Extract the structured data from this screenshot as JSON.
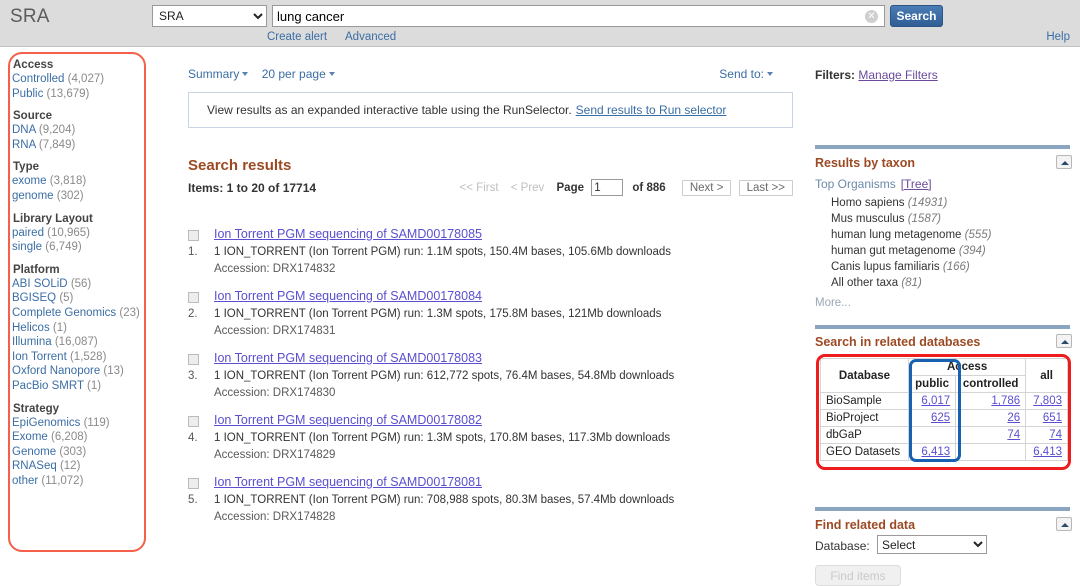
{
  "header": {
    "logo": "SRA",
    "db_selected": "SRA",
    "db_options": [
      "SRA"
    ],
    "search_value": "lung cancer ",
    "search_placeholder": "",
    "clear_icon": "clear-icon",
    "search_button": "Search",
    "create_alert": "Create alert",
    "advanced": "Advanced",
    "help": "Help"
  },
  "facets": [
    {
      "title": "Access",
      "items": [
        {
          "label": "Controlled",
          "count": "(4,027)"
        },
        {
          "label": "Public",
          "count": "(13,679)"
        }
      ]
    },
    {
      "title": "Source",
      "items": [
        {
          "label": "DNA",
          "count": "(9,204)"
        },
        {
          "label": "RNA",
          "count": "(7,849)"
        }
      ]
    },
    {
      "title": "Type",
      "items": [
        {
          "label": "exome",
          "count": "(3,818)"
        },
        {
          "label": "genome",
          "count": "(302)"
        }
      ]
    },
    {
      "title": "Library Layout",
      "items": [
        {
          "label": "paired",
          "count": "(10,965)"
        },
        {
          "label": "single",
          "count": "(6,749)"
        }
      ]
    },
    {
      "title": "Platform",
      "items": [
        {
          "label": "ABI SOLiD",
          "count": "(56)"
        },
        {
          "label": "BGISEQ",
          "count": "(5)"
        },
        {
          "label": "Complete Genomics",
          "count": "(23)"
        },
        {
          "label": "Helicos",
          "count": "(1)"
        },
        {
          "label": "Illumina",
          "count": "(16,087)"
        },
        {
          "label": "Ion Torrent",
          "count": "(1,528)"
        },
        {
          "label": "Oxford Nanopore",
          "count": "(13)"
        },
        {
          "label": "PacBio SMRT",
          "count": "(1)"
        }
      ]
    },
    {
      "title": "Strategy",
      "items": [
        {
          "label": "EpiGenomics",
          "count": "(119)"
        },
        {
          "label": "Exome",
          "count": "(6,208)"
        },
        {
          "label": "Genome",
          "count": "(303)"
        },
        {
          "label": "RNASeq",
          "count": "(12)"
        },
        {
          "label": "other",
          "count": "(11,072)"
        }
      ]
    }
  ],
  "display_bar": {
    "summary": "Summary",
    "per_page": "20 per page",
    "send_to": "Send to:"
  },
  "runselector": {
    "text": "View results as an expanded interactive table using the RunSelector.",
    "link": "Send results to Run selector"
  },
  "results": {
    "title": "Search results",
    "items_count": "Items: 1 to 20 of 17714",
    "pager": {
      "first": "<< First",
      "prev": "< Prev",
      "page_label": "Page",
      "page_value": "1",
      "of": "of 886",
      "next": "Next >",
      "last": "Last >>"
    },
    "list": [
      {
        "num": "1.",
        "title": "Ion Torrent PGM sequencing of SAMD00178085",
        "meta": "1 ION_TORRENT (Ion Torrent PGM) run: 1.1M spots, 150.4M bases, 105.6Mb downloads",
        "accession": "Accession: DRX174832"
      },
      {
        "num": "2.",
        "title": "Ion Torrent PGM sequencing of SAMD00178084",
        "meta": "1 ION_TORRENT (Ion Torrent PGM) run: 1.3M spots, 175.8M bases, 121Mb downloads",
        "accession": "Accession: DRX174831"
      },
      {
        "num": "3.",
        "title": "Ion Torrent PGM sequencing of SAMD00178083",
        "meta": "1 ION_TORRENT (Ion Torrent PGM) run: 612,772 spots, 76.4M bases, 54.8Mb downloads",
        "accession": "Accession: DRX174830"
      },
      {
        "num": "4.",
        "title": "Ion Torrent PGM sequencing of SAMD00178082",
        "meta": "1 ION_TORRENT (Ion Torrent PGM) run: 1.3M spots, 170.8M bases, 117.3Mb downloads",
        "accession": "Accession: DRX174829"
      },
      {
        "num": "5.",
        "title": "Ion Torrent PGM sequencing of SAMD00178081",
        "meta": "1 ION_TORRENT (Ion Torrent PGM) run: 708,988 spots, 80.3M bases, 57.4Mb downloads",
        "accession": "Accession: DRX174828"
      }
    ]
  },
  "right": {
    "filters_label": "Filters:",
    "manage_filters": "Manage Filters",
    "taxon": {
      "heading": "Results by taxon",
      "top_organisms": "Top Organisms",
      "tree": "[Tree]",
      "items": [
        {
          "name": "Homo sapiens",
          "count": "(14931)"
        },
        {
          "name": "Mus musculus",
          "count": "(1587)"
        },
        {
          "name": "human lung metagenome",
          "count": "(555)"
        },
        {
          "name": "human gut metagenome",
          "count": "(394)"
        },
        {
          "name": "Canis lupus familiaris",
          "count": "(166)"
        },
        {
          "name": "All other taxa",
          "count": "(81)"
        }
      ],
      "more": "More..."
    },
    "related_db": {
      "heading": "Search in related databases",
      "col_database": "Database",
      "col_access": "Access",
      "col_public": "public",
      "col_controlled": "controlled",
      "col_all": "all",
      "rows": [
        {
          "database": "BioSample",
          "public": "6,017",
          "controlled": "1,786",
          "all": "7,803"
        },
        {
          "database": "BioProject",
          "public": "625",
          "controlled": "26",
          "all": "651"
        },
        {
          "database": "dbGaP",
          "public": "",
          "controlled": "74",
          "all": "74"
        },
        {
          "database": "GEO Datasets",
          "public": "6,413",
          "controlled": "",
          "all": "6,413"
        }
      ]
    },
    "find_related": {
      "heading": "Find related data",
      "database_label": "Database:",
      "select_value": "Select",
      "select_options": [
        "Select"
      ],
      "find_items": "Find items"
    }
  },
  "colors": {
    "header_bg": "#dcdcdc",
    "link_blue": "#3b6ea5",
    "result_link": "#5a4fd0",
    "section_heading": "#9c4a23",
    "highlight_red": "#ee1c1c",
    "facet_outline": "#f4604a",
    "highlight_blue": "#1761b0",
    "search_btn": "#3a6ea5"
  }
}
